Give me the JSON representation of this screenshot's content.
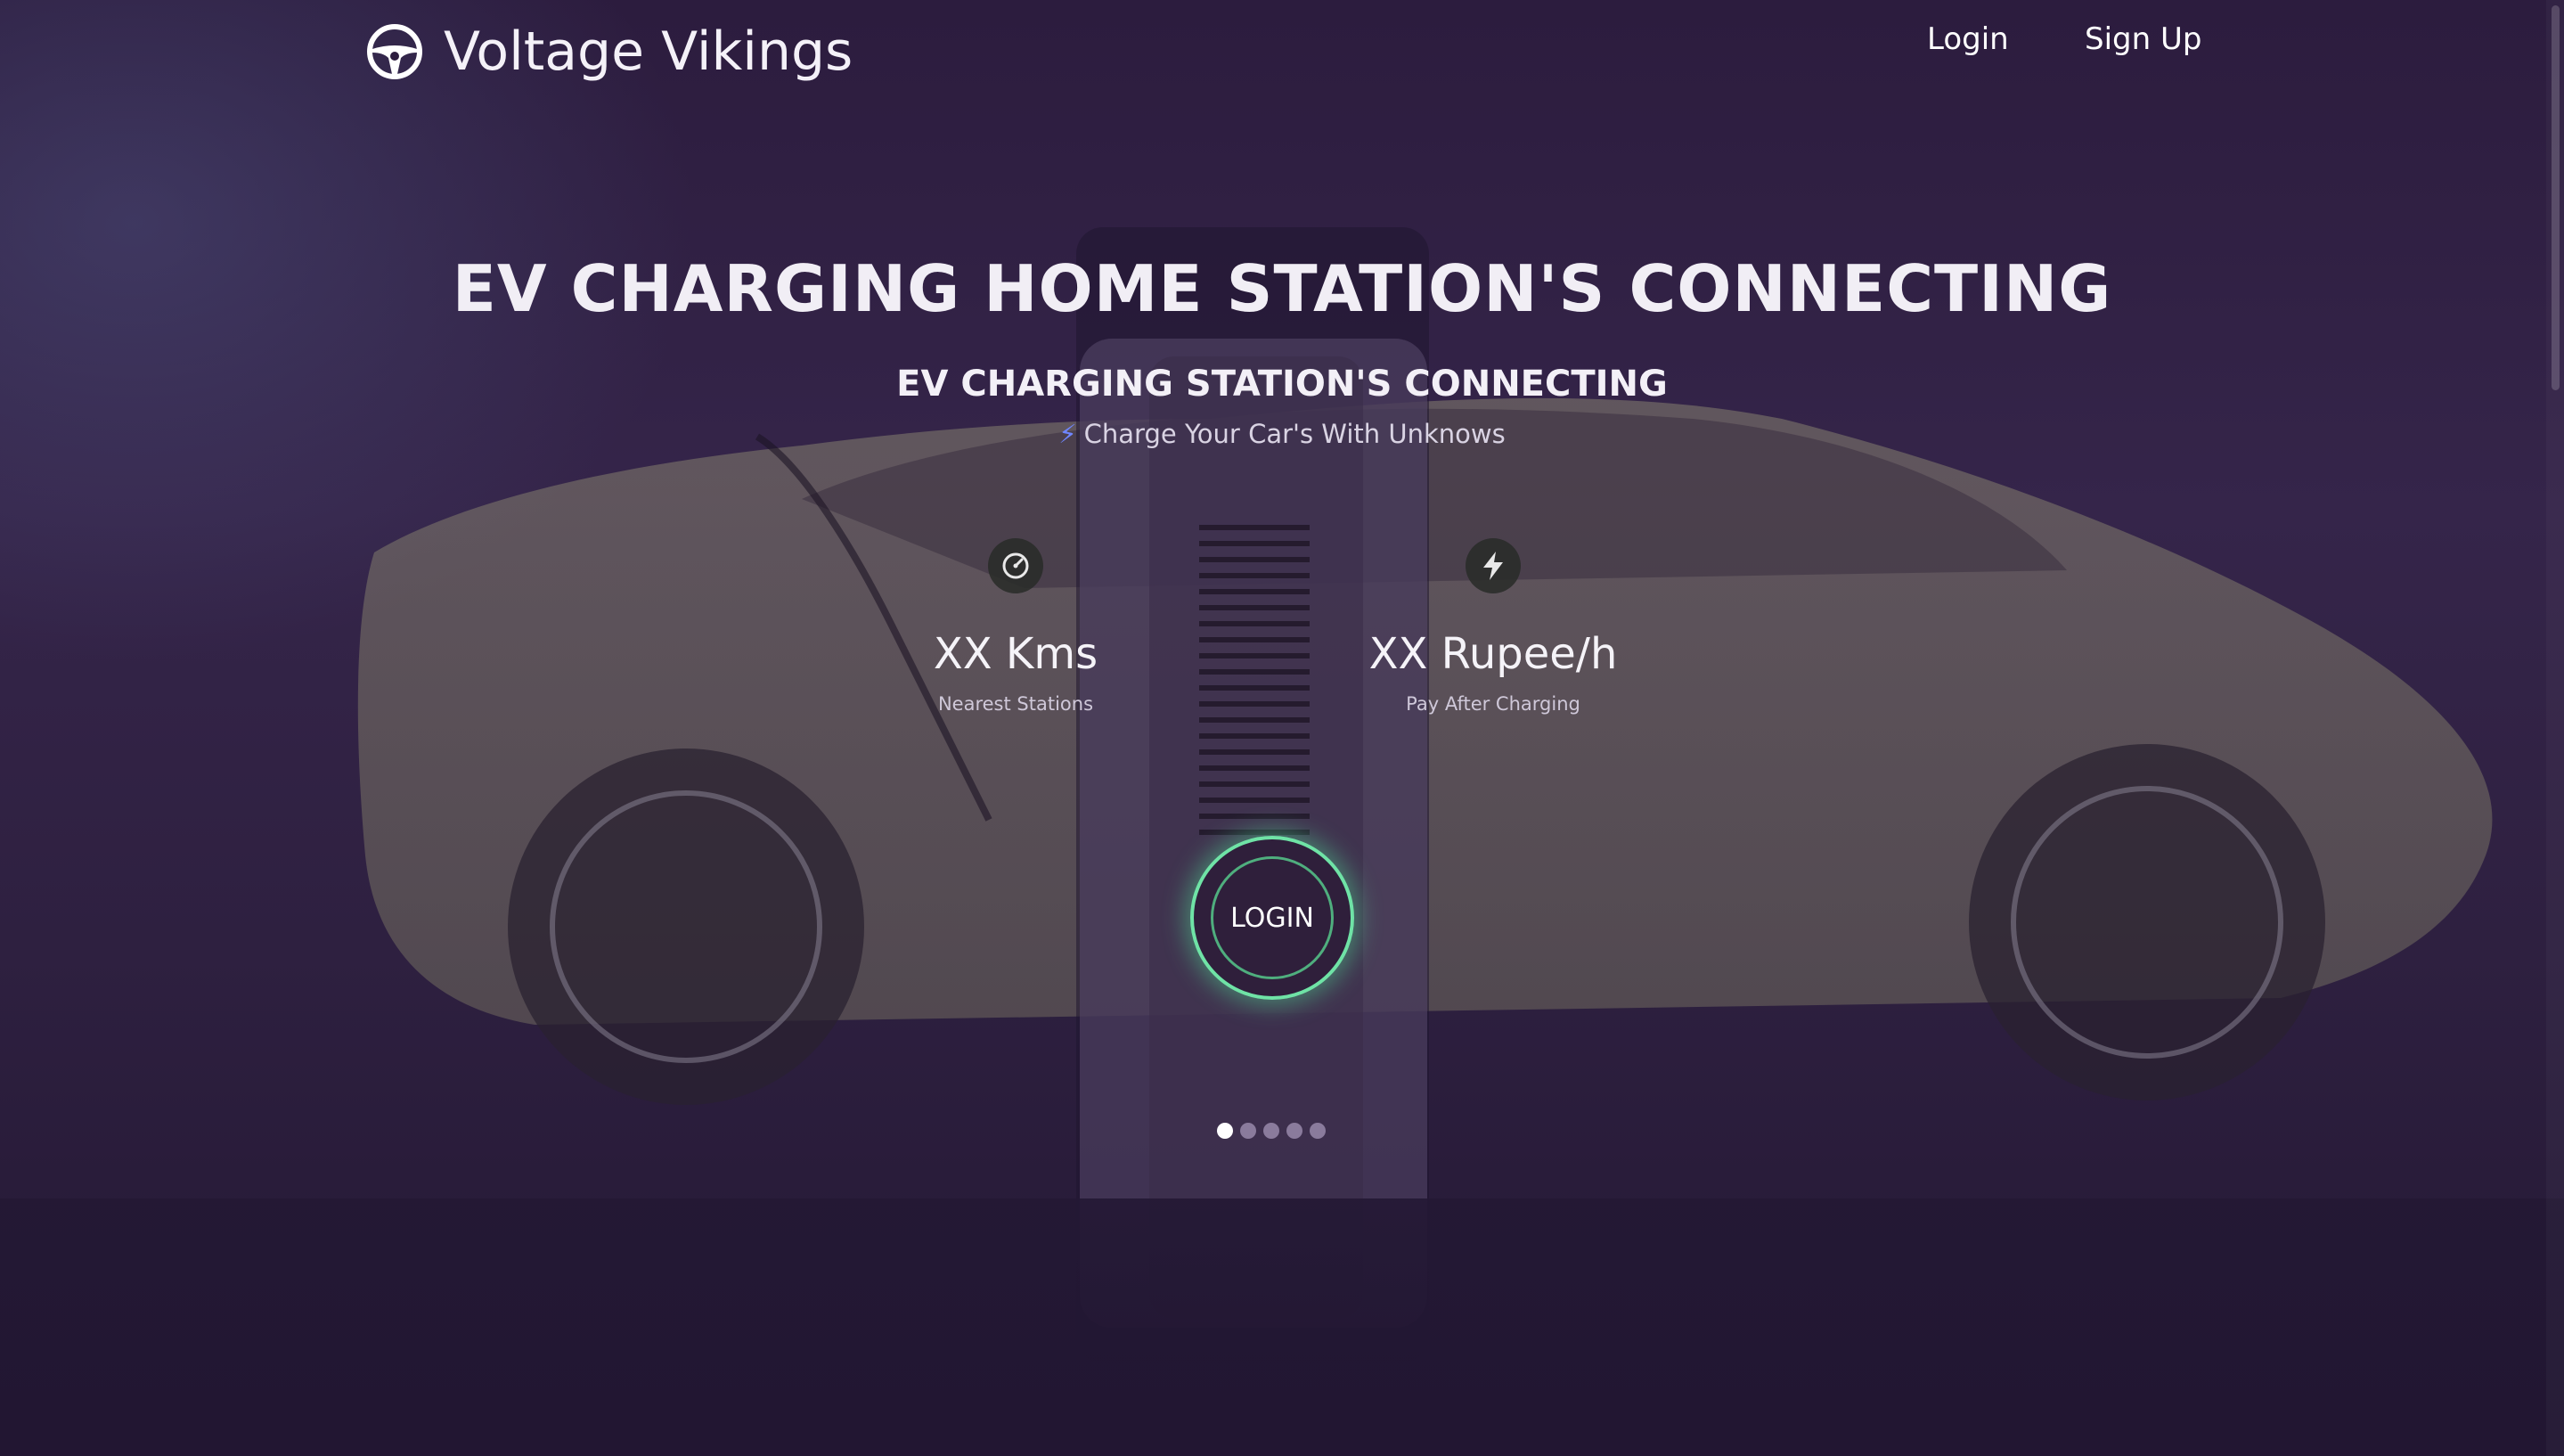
{
  "brand": {
    "name": "Voltage Vikings",
    "icon": "steering-wheel-icon"
  },
  "nav": {
    "login_label": "Login",
    "signup_label": "Sign Up"
  },
  "hero": {
    "headline": "EV CHARGING HOME STATION'S CONNECTING",
    "subheadline": "EV CHARGING STATION'S CONNECTING",
    "tagline": "Charge Your Car's With Unknows",
    "tagline_icon": "bolt-icon"
  },
  "stats": [
    {
      "icon": "speedometer-icon",
      "value": "XX Kms",
      "label": "Nearest Stations"
    },
    {
      "icon": "bolt-icon",
      "value": "XX Rupee/h",
      "label": "Pay After Charging"
    }
  ],
  "cta": {
    "label": "LOGIN"
  },
  "carousel": {
    "slide_count": 5,
    "active_index": 0
  },
  "colors": {
    "background": "#2c1c3e",
    "cta_ring": "#6fe3a6",
    "tagline_bolt": "#6f86ff",
    "text": "#ffffff"
  }
}
